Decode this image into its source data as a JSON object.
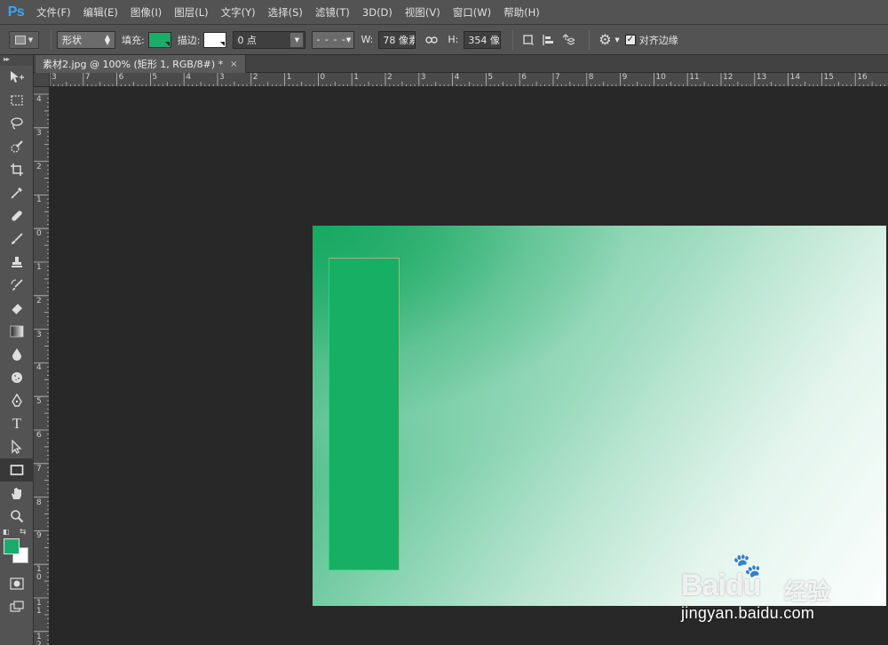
{
  "app": {
    "logo": "Ps"
  },
  "menubar": {
    "items": [
      "文件(F)",
      "编辑(E)",
      "图像(I)",
      "图层(L)",
      "文字(Y)",
      "选择(S)",
      "滤镜(T)",
      "3D(D)",
      "视图(V)",
      "窗口(W)",
      "帮助(H)"
    ]
  },
  "options": {
    "tool_preset_icon": "rectangle-tool-icon",
    "mode": "形状",
    "fill_label": "填充:",
    "fill_color": "#1aad6a",
    "stroke_label": "描边:",
    "stroke_color": "#ffffff",
    "stroke_width": "0 点",
    "stroke_style": "- - - -",
    "width_label": "W:",
    "width_value": "78 像素",
    "height_label": "H:",
    "height_value": "354 像",
    "align_edges_label": "对齐边缘",
    "align_edges_checked": true
  },
  "document": {
    "tab_title": "素材2.jpg @ 100% (矩形 1, RGB/8#) *"
  },
  "ruler": {
    "top_labels": [
      "3",
      "7",
      "6",
      "5",
      "4",
      "3",
      "2",
      "1",
      "0",
      "1",
      "2",
      "3",
      "4",
      "5",
      "6",
      "7",
      "8",
      "9",
      "10",
      "11",
      "12",
      "13",
      "14",
      "15",
      "16"
    ],
    "left_labels": [
      "4",
      "3",
      "2",
      "1",
      "0",
      "1",
      "2",
      "3",
      "4",
      "5",
      "6",
      "7",
      "8",
      "9",
      "1 0",
      "1 1",
      "1 2"
    ]
  },
  "colors": {
    "foreground": "#1aad6a",
    "background": "#ffffff",
    "shape_fill": "#16af64"
  },
  "watermark": {
    "brand": "Baidu",
    "product": "经验",
    "url": "jingyan.baidu.com"
  }
}
